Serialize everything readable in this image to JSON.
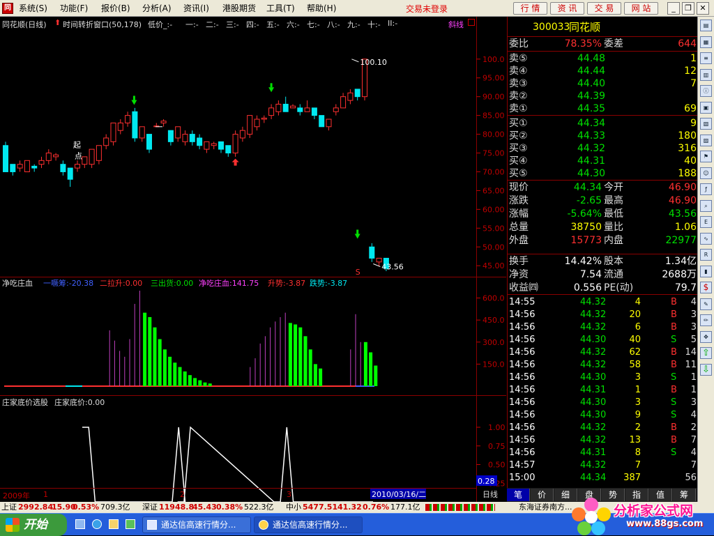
{
  "menubar": {
    "items": [
      "系统(S)",
      "功能(F)",
      "报价(B)",
      "分析(A)",
      "资讯(I)",
      "港股期货",
      "工具(T)",
      "帮助(H)"
    ],
    "login_status": "交易未登录",
    "buttons": [
      "行 情",
      "资 讯",
      "交 易",
      "网 站"
    ]
  },
  "chart_header": {
    "title": "同花顺(日线)",
    "indicator": "时间转折窗口(50,178)",
    "low": "低价_:-",
    "labels": [
      "一:-",
      "二:-",
      "三:-",
      "四:-",
      "五:-",
      "六:-",
      "七:-",
      "八:-",
      "九:-",
      "十:-",
      "II:-"
    ],
    "tag": "斜线"
  },
  "price_chart": {
    "high_label": "100.10",
    "low_label": "43.56",
    "start_label_1": "起",
    "start_label_2": "点",
    "s_marker": "S",
    "y_ticks": [
      "100.0",
      "95.00",
      "90.00",
      "85.00",
      "80.00",
      "75.00",
      "70.00",
      "65.00",
      "60.00",
      "55.00",
      "50.00",
      "45.00"
    ]
  },
  "chart_data": [
    {
      "type": "candlestick",
      "title": "同花顺(日线)",
      "ylim": [
        43,
        102
      ],
      "candles": [
        {
          "o": 70,
          "c": 77,
          "h": 78,
          "l": 70,
          "d": "down"
        },
        {
          "o": 72,
          "c": 70,
          "h": 72,
          "l": 69,
          "d": "down"
        },
        {
          "o": 71,
          "c": 72,
          "h": 73,
          "l": 70,
          "d": "up"
        },
        {
          "o": 70,
          "c": 73,
          "h": 73,
          "l": 70,
          "d": "up"
        },
        {
          "o": 71,
          "c": 71.5,
          "h": 72,
          "l": 70,
          "d": "down"
        },
        {
          "o": 73,
          "c": 72,
          "h": 74,
          "l": 71,
          "d": "up"
        },
        {
          "o": 73,
          "c": 75,
          "h": 76,
          "l": 72,
          "d": "up"
        },
        {
          "o": 74,
          "c": 74.5,
          "h": 75,
          "l": 73,
          "d": "up"
        },
        {
          "o": 72,
          "c": 70,
          "h": 73,
          "l": 69,
          "d": "down"
        },
        {
          "o": 71,
          "c": 68,
          "h": 71,
          "l": 66,
          "d": "down"
        },
        {
          "o": 71,
          "c": 72,
          "h": 73,
          "l": 70,
          "d": "up"
        },
        {
          "o": 72,
          "c": 74,
          "h": 74,
          "l": 71,
          "d": "up"
        },
        {
          "o": 72,
          "c": 76,
          "h": 76,
          "l": 71,
          "d": "up"
        },
        {
          "o": 73,
          "c": 77,
          "h": 77,
          "l": 72,
          "d": "up"
        },
        {
          "o": 77,
          "c": 79,
          "h": 80,
          "l": 76,
          "d": "up"
        },
        {
          "o": 78,
          "c": 83,
          "h": 83,
          "l": 77,
          "d": "up"
        },
        {
          "o": 81,
          "c": 83,
          "h": 84,
          "l": 80,
          "d": "up"
        },
        {
          "o": 83,
          "c": 85,
          "h": 86,
          "l": 82,
          "d": "up"
        },
        {
          "o": 86,
          "c": 79,
          "h": 87,
          "l": 78,
          "d": "down"
        },
        {
          "o": 79,
          "c": 82,
          "h": 82,
          "l": 78,
          "d": "up"
        },
        {
          "o": 80,
          "c": 76,
          "h": 80,
          "l": 75,
          "d": "down"
        },
        {
          "o": 82,
          "c": 82.2,
          "h": 83,
          "l": 82,
          "d": "up"
        },
        {
          "o": 83,
          "c": 83.5,
          "h": 84,
          "l": 82,
          "d": "up"
        },
        {
          "o": 81,
          "c": 78,
          "h": 81,
          "l": 77,
          "d": "down"
        },
        {
          "o": 79,
          "c": 82,
          "h": 82,
          "l": 78,
          "d": "up"
        },
        {
          "o": 78,
          "c": 80,
          "h": 81,
          "l": 77,
          "d": "up"
        },
        {
          "o": 80,
          "c": 78,
          "h": 81,
          "l": 77,
          "d": "down"
        },
        {
          "o": 79,
          "c": 77,
          "h": 80,
          "l": 76,
          "d": "down"
        },
        {
          "o": 76,
          "c": 78,
          "h": 78,
          "l": 75,
          "d": "up"
        },
        {
          "o": 77,
          "c": 77.5,
          "h": 78,
          "l": 76,
          "d": "up"
        },
        {
          "o": 78,
          "c": 76,
          "h": 78,
          "l": 75,
          "d": "down"
        },
        {
          "o": 77,
          "c": 75,
          "h": 77,
          "l": 74,
          "d": "down"
        },
        {
          "o": 75,
          "c": 80,
          "h": 81,
          "l": 74,
          "d": "up"
        },
        {
          "o": 79,
          "c": 81,
          "h": 82,
          "l": 78,
          "d": "up"
        },
        {
          "o": 80,
          "c": 85,
          "h": 85,
          "l": 79,
          "d": "up"
        },
        {
          "o": 82,
          "c": 84,
          "h": 85,
          "l": 81,
          "d": "up"
        },
        {
          "o": 84,
          "c": 84.3,
          "h": 85,
          "l": 83,
          "d": "up"
        },
        {
          "o": 85,
          "c": 87,
          "h": 88,
          "l": 84,
          "d": "up"
        },
        {
          "o": 86,
          "c": 88,
          "h": 89,
          "l": 85,
          "d": "up"
        },
        {
          "o": 88,
          "c": 86,
          "h": 90,
          "l": 86,
          "d": "down"
        },
        {
          "o": 87,
          "c": 87.5,
          "h": 88,
          "l": 87,
          "d": "up"
        },
        {
          "o": 87,
          "c": 86,
          "h": 88,
          "l": 85,
          "d": "down"
        },
        {
          "o": 86,
          "c": 87,
          "h": 89,
          "l": 86,
          "d": "up"
        },
        {
          "o": 87,
          "c": 85,
          "h": 87,
          "l": 84,
          "d": "down"
        },
        {
          "o": 85,
          "c": 82,
          "h": 85,
          "l": 82,
          "d": "down"
        },
        {
          "o": 84,
          "c": 82,
          "h": 84,
          "l": 81,
          "d": "up"
        },
        {
          "o": 86,
          "c": 87,
          "h": 88,
          "l": 85,
          "d": "up"
        },
        {
          "o": 87,
          "c": 90,
          "h": 91,
          "l": 87,
          "d": "up"
        },
        {
          "o": 89,
          "c": 91,
          "h": 92,
          "l": 88,
          "d": "up"
        },
        {
          "o": 92,
          "c": 90,
          "h": 92,
          "l": 89,
          "d": "down"
        },
        {
          "o": 90,
          "c": 100,
          "h": 100.1,
          "l": 89,
          "d": "up"
        },
        {
          "o": 50,
          "c": 47,
          "h": 51,
          "l": 46,
          "d": "down"
        },
        {
          "o": 47,
          "c": 46,
          "h": 47,
          "l": 45,
          "d": "up"
        },
        {
          "o": 47,
          "c": 44.3,
          "h": 47,
          "l": 43.56,
          "d": "down"
        }
      ]
    },
    {
      "type": "bar",
      "title": "净吃庄血",
      "ylim": [
        0,
        650
      ],
      "series": [
        {
          "name": "一噘筹",
          "value_text": "-20.38"
        },
        {
          "name": "二拉升",
          "value_text": "0.00"
        },
        {
          "name": "三出货",
          "value_text": "0.00"
        },
        {
          "name": "净吃庄血",
          "value_text": "141.75"
        },
        {
          "name": "升势",
          "value_text": "-3.87"
        },
        {
          "name": "跌势",
          "value_text": "-3.87"
        }
      ],
      "purple_bars": [
        {
          "i": 21,
          "v": 380
        },
        {
          "i": 22,
          "v": 310
        },
        {
          "i": 23,
          "v": 240
        },
        {
          "i": 24,
          "v": 200
        },
        {
          "i": 25,
          "v": 320
        },
        {
          "i": 26,
          "v": 560
        },
        {
          "i": 27,
          "v": 650
        },
        {
          "i": 49,
          "v": 130
        },
        {
          "i": 50,
          "v": 190
        },
        {
          "i": 51,
          "v": 290
        },
        {
          "i": 52,
          "v": 340
        },
        {
          "i": 53,
          "v": 400
        },
        {
          "i": 54,
          "v": 440
        },
        {
          "i": 55,
          "v": 470
        },
        {
          "i": 56,
          "v": 500
        },
        {
          "i": 69,
          "v": 250
        },
        {
          "i": 70,
          "v": 490
        },
        {
          "i": 71,
          "v": 300
        }
      ],
      "green_bars": [
        {
          "i": 28,
          "v": 500
        },
        {
          "i": 29,
          "v": 470
        },
        {
          "i": 30,
          "v": 400
        },
        {
          "i": 31,
          "v": 320
        },
        {
          "i": 32,
          "v": 250
        },
        {
          "i": 33,
          "v": 200
        },
        {
          "i": 34,
          "v": 160
        },
        {
          "i": 35,
          "v": 130
        },
        {
          "i": 36,
          "v": 100
        },
        {
          "i": 37,
          "v": 75
        },
        {
          "i": 38,
          "v": 55
        },
        {
          "i": 39,
          "v": 40
        },
        {
          "i": 40,
          "v": 25
        },
        {
          "i": 41,
          "v": 18
        },
        {
          "i": 57,
          "v": 430
        },
        {
          "i": 58,
          "v": 420
        },
        {
          "i": 59,
          "v": 400
        },
        {
          "i": 60,
          "v": 340
        },
        {
          "i": 61,
          "v": 250
        },
        {
          "i": 62,
          "v": 150
        },
        {
          "i": 63,
          "v": 120
        },
        {
          "i": 72,
          "v": 300
        },
        {
          "i": 73,
          "v": 230
        },
        {
          "i": 74,
          "v": 140
        }
      ],
      "y_ticks": [
        "600.0",
        "450.0",
        "300.0",
        "150.0"
      ]
    },
    {
      "type": "line",
      "title": "庄家底价选股",
      "series": [
        {
          "name": "庄家底价",
          "value_text": "0.00"
        }
      ],
      "ylim": [
        0,
        1
      ],
      "x": [
        0,
        1,
        2,
        14,
        15,
        16,
        17,
        18,
        19,
        32,
        33,
        34,
        35,
        36,
        37
      ],
      "y": [
        1,
        1,
        0,
        0,
        1,
        0,
        0,
        0,
        1,
        0,
        0,
        1,
        0,
        0,
        0
      ],
      "current_value": "0.28",
      "y_ticks": [
        "1.00",
        "0.75",
        "0.50",
        "0.25"
      ],
      "x_labels": [
        "2009年",
        "1",
        "2",
        "3"
      ],
      "date_label": "2010/03/16/二",
      "period": "日线"
    }
  ],
  "quote": {
    "code": "300033",
    "name": "同花顺",
    "weibi_label": "委比",
    "weibi_value": "78.35%",
    "weicha_label": "委差",
    "weicha_value": "644",
    "sell": [
      {
        "label": "卖⑤",
        "price": "44.48",
        "vol": "1"
      },
      {
        "label": "卖④",
        "price": "44.44",
        "vol": "12"
      },
      {
        "label": "卖③",
        "price": "44.40",
        "vol": "7"
      },
      {
        "label": "卖②",
        "price": "44.39",
        "vol": ""
      },
      {
        "label": "卖①",
        "price": "44.35",
        "vol": "69"
      }
    ],
    "buy": [
      {
        "label": "买①",
        "price": "44.34",
        "vol": "9"
      },
      {
        "label": "买②",
        "price": "44.33",
        "vol": "180"
      },
      {
        "label": "买③",
        "price": "44.32",
        "vol": "316"
      },
      {
        "label": "买④",
        "price": "44.31",
        "vol": "40"
      },
      {
        "label": "买⑤",
        "price": "44.30",
        "vol": "188"
      }
    ],
    "stats": [
      {
        "l1": "现价",
        "v1": "44.34",
        "c1": "#00e000",
        "l2": "今开",
        "v2": "46.90",
        "c2": "#ff3030"
      },
      {
        "l1": "涨跌",
        "v1": "-2.65",
        "c1": "#00e000",
        "l2": "最高",
        "v2": "46.90",
        "c2": "#ff3030"
      },
      {
        "l1": "涨幅",
        "v1": "-5.64%",
        "c1": "#00e000",
        "l2": "最低",
        "v2": "43.56",
        "c2": "#00e000"
      },
      {
        "l1": "总量",
        "v1": "38750",
        "c1": "#ffff00",
        "l2": "量比",
        "v2": "1.06",
        "c2": "#ffff00"
      },
      {
        "l1": "外盘",
        "v1": "15773",
        "c1": "#ff3030",
        "l2": "内盘",
        "v2": "22977",
        "c2": "#00e000"
      }
    ],
    "stats2": [
      {
        "l1": "换手",
        "v1": "14.42%",
        "l2": "股本",
        "v2": "1.34亿"
      },
      {
        "l1": "净资",
        "v1": "7.54",
        "l2": "流通",
        "v2": "2688万"
      },
      {
        "l1": "收益㈣",
        "v1": "0.556",
        "l2": "PE(动)",
        "v2": "79.7"
      }
    ],
    "ticks": [
      {
        "t": "14:55",
        "p": "44.32",
        "v": "4",
        "bs": "B",
        "n": "4"
      },
      {
        "t": "14:56",
        "p": "44.32",
        "v": "20",
        "bs": "B",
        "n": "3"
      },
      {
        "t": "14:56",
        "p": "44.32",
        "v": "6",
        "bs": "B",
        "n": "3"
      },
      {
        "t": "14:56",
        "p": "44.30",
        "v": "40",
        "bs": "S",
        "n": "5"
      },
      {
        "t": "14:56",
        "p": "44.32",
        "v": "62",
        "bs": "B",
        "n": "14"
      },
      {
        "t": "14:56",
        "p": "44.32",
        "v": "58",
        "bs": "B",
        "n": "11"
      },
      {
        "t": "14:56",
        "p": "44.30",
        "v": "3",
        "bs": "S",
        "n": "1"
      },
      {
        "t": "14:56",
        "p": "44.31",
        "v": "1",
        "bs": "B",
        "n": "1"
      },
      {
        "t": "14:56",
        "p": "44.30",
        "v": "3",
        "bs": "S",
        "n": "3"
      },
      {
        "t": "14:56",
        "p": "44.30",
        "v": "9",
        "bs": "S",
        "n": "4"
      },
      {
        "t": "14:56",
        "p": "44.32",
        "v": "2",
        "bs": "B",
        "n": "2"
      },
      {
        "t": "14:56",
        "p": "44.32",
        "v": "13",
        "bs": "B",
        "n": "7"
      },
      {
        "t": "14:56",
        "p": "44.31",
        "v": "8",
        "bs": "S",
        "n": "4"
      },
      {
        "t": "14:57",
        "p": "44.32",
        "v": "7",
        "bs": "",
        "n": "7"
      },
      {
        "t": "15:00",
        "p": "44.34",
        "v": "387",
        "bs": "",
        "n": "56"
      }
    ],
    "tabs": [
      "笔",
      "价",
      "细",
      "盘",
      "势",
      "指",
      "值",
      "筹"
    ]
  },
  "statusbar": {
    "items": [
      {
        "text": "上证",
        "c": "#000"
      },
      {
        "text": "2992.84",
        "c": "#d00000"
      },
      {
        "text": "15.90",
        "c": "#d00000"
      },
      {
        "text": "0.53%",
        "c": "#d00000"
      },
      {
        "text": "709.3亿",
        "c": "#000"
      },
      {
        "text": "深证",
        "c": "#000"
      },
      {
        "text": "11948.8",
        "c": "#d00000"
      },
      {
        "text": "45.43",
        "c": "#d00000"
      },
      {
        "text": "0.38%",
        "c": "#d00000"
      },
      {
        "text": "522.3亿",
        "c": "#000"
      },
      {
        "text": "中小",
        "c": "#000"
      },
      {
        "text": "5477.51",
        "c": "#d00000"
      },
      {
        "text": "41.32",
        "c": "#d00000"
      },
      {
        "text": "0.76%",
        "c": "#d00000"
      },
      {
        "text": "177.1亿",
        "c": "#000"
      }
    ],
    "broker": "东海证券南方..."
  },
  "taskbar": {
    "start": "开始",
    "tasks": [
      "通达信高速行情分...",
      "通达信高速行情分..."
    ]
  },
  "logo": {
    "title": "分析家公式网",
    "url": "www.88gs.com"
  }
}
